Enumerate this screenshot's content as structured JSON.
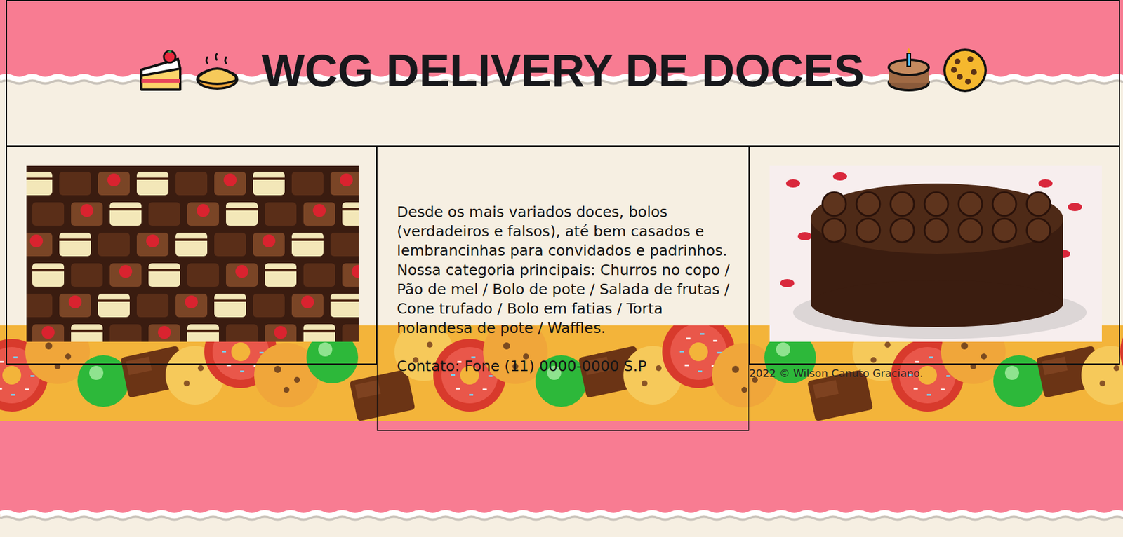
{
  "header": {
    "title": "WCG DELIVERY DE DOCES"
  },
  "description": {
    "paragraphs": [
      "Desde os mais variados doces, bolos (verdadeiros e falsos), até bem casados e lembrancinhas para convidados e padrinhos. Nossa categoria principais: Churros no copo / Pão de mel / Bolo de pote / Salada de frutas / Cone trufado / Bolo em fatias / Torta holandesa de pote / Waffles.",
      "Contato: Fone (11) 0000-0000 S.P"
    ]
  },
  "footer": {
    "copyright": "2022 © Wilson Canuto Graciano."
  }
}
